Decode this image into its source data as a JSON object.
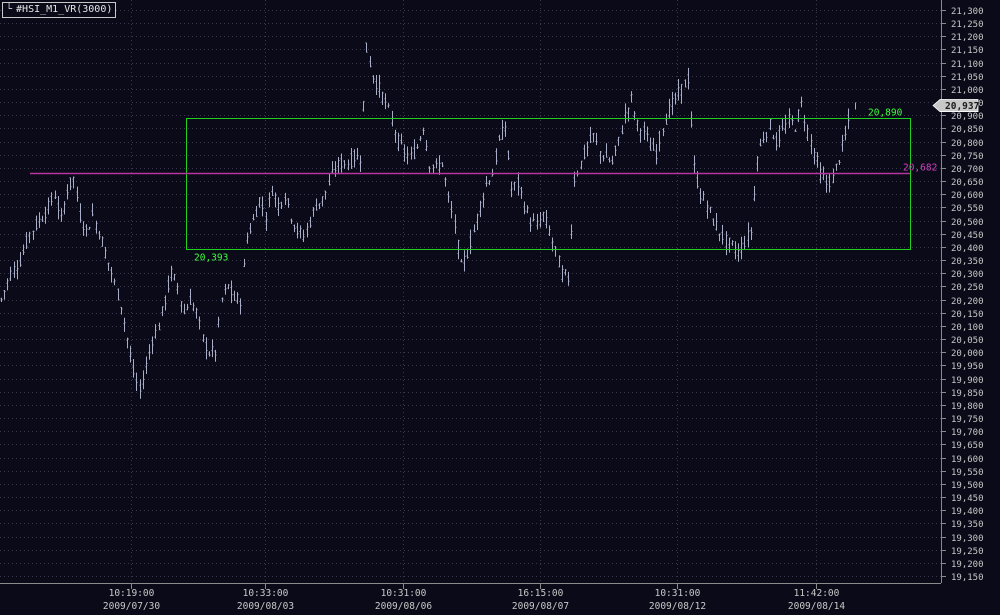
{
  "window": {
    "title": "#HSI_M1_VR(3000)",
    "corner_icon": "chart-corner-icon"
  },
  "colors": {
    "background": "#0b0a18",
    "bars": "#a8aec8",
    "grid": "#3a3a4a",
    "range_box": "#1fd11f",
    "pivot_line": "#b5359e",
    "pivot_label": "#d040c0",
    "range_label": "#3cff3c",
    "price_tag_bg": "#c8c8c8",
    "axis_text": "#c8c8c8"
  },
  "chart_data": {
    "type": "ohlc",
    "title": "#HSI_M1_VR(3000)",
    "xlabel": "",
    "ylabel": "",
    "ylim": [
      19125,
      21325
    ],
    "grid": true,
    "y_ticks": [
      "21,300",
      "21,250",
      "21,200",
      "21,150",
      "21,100",
      "21,050",
      "21,000",
      "20,950",
      "20,900",
      "20,850",
      "20,800",
      "20,750",
      "20,700",
      "20,650",
      "20,600",
      "20,550",
      "20,500",
      "20,450",
      "20,400",
      "20,350",
      "20,300",
      "20,250",
      "20,200",
      "20,150",
      "20,100",
      "20,050",
      "20,000",
      "19,950",
      "19,900",
      "19,850",
      "19,800",
      "19,750",
      "19,700",
      "19,650",
      "19,600",
      "19,550",
      "19,500",
      "19,450",
      "19,400",
      "19,350",
      "19,300",
      "19,250",
      "19,200",
      "19,150"
    ],
    "x_ticks": [
      {
        "time": "10:19:00",
        "date": "2009/07/30"
      },
      {
        "time": "10:33:00",
        "date": "2009/08/03"
      },
      {
        "time": "10:31:00",
        "date": "2009/08/06"
      },
      {
        "time": "16:15:00",
        "date": "2009/08/07"
      },
      {
        "time": "10:31:00",
        "date": "2009/08/12"
      },
      {
        "time": "11:42:00",
        "date": "2009/08/14"
      }
    ],
    "current_price": "20,937",
    "current_price_value": 20937,
    "range": {
      "upper": 20890,
      "upper_label": "20,890",
      "lower": 20393,
      "lower_label": "20,393"
    },
    "pivot": {
      "value": 20682,
      "label": "20,682"
    },
    "close_path": [
      [
        0,
        20200
      ],
      [
        3,
        20300
      ],
      [
        6,
        20350
      ],
      [
        9,
        20450
      ],
      [
        12,
        20500
      ],
      [
        15,
        20550
      ],
      [
        17,
        20600
      ],
      [
        19,
        20500
      ],
      [
        21,
        20620
      ],
      [
        23,
        20660
      ],
      [
        25,
        20520
      ],
      [
        27,
        20460
      ],
      [
        29,
        20520
      ],
      [
        31,
        20460
      ],
      [
        33,
        20380
      ],
      [
        35,
        20300
      ],
      [
        38,
        20180
      ],
      [
        40,
        20050
      ],
      [
        42,
        19920
      ],
      [
        44,
        19850
      ],
      [
        46,
        19950
      ],
      [
        48,
        20050
      ],
      [
        50,
        20100
      ],
      [
        52,
        20200
      ],
      [
        54,
        20300
      ],
      [
        56,
        20250
      ],
      [
        58,
        20150
      ],
      [
        60,
        20200
      ],
      [
        62,
        20150
      ],
      [
        64,
        20050
      ],
      [
        66,
        20000
      ],
      [
        68,
        20000
      ],
      [
        70,
        20200
      ],
      [
        72,
        20250
      ],
      [
        74,
        20200
      ],
      [
        76,
        20200
      ],
      [
        78,
        20440
      ],
      [
        80,
        20500
      ],
      [
        82,
        20580
      ],
      [
        84,
        20520
      ],
      [
        86,
        20620
      ],
      [
        88,
        20560
      ],
      [
        90,
        20600
      ],
      [
        92,
        20520
      ],
      [
        94,
        20460
      ],
      [
        96,
        20440
      ],
      [
        98,
        20500
      ],
      [
        100,
        20560
      ],
      [
        102,
        20580
      ],
      [
        104,
        20640
      ],
      [
        106,
        20700
      ],
      [
        108,
        20720
      ],
      [
        110,
        20720
      ],
      [
        112,
        20740
      ],
      [
        114,
        20740
      ],
      [
        116,
        21150
      ],
      [
        118,
        21050
      ],
      [
        120,
        21000
      ],
      [
        122,
        20950
      ],
      [
        124,
        20880
      ],
      [
        126,
        20800
      ],
      [
        128,
        20760
      ],
      [
        130,
        20740
      ],
      [
        132,
        20780
      ],
      [
        134,
        20860
      ],
      [
        136,
        20720
      ],
      [
        138,
        20700
      ],
      [
        140,
        20720
      ],
      [
        142,
        20580
      ],
      [
        144,
        20480
      ],
      [
        146,
        20320
      ],
      [
        148,
        20380
      ],
      [
        150,
        20460
      ],
      [
        152,
        20560
      ],
      [
        154,
        20640
      ],
      [
        156,
        20680
      ],
      [
        158,
        20800
      ],
      [
        160,
        20860
      ],
      [
        162,
        20620
      ],
      [
        164,
        20640
      ],
      [
        166,
        20560
      ],
      [
        168,
        20500
      ],
      [
        170,
        20480
      ],
      [
        172,
        20520
      ],
      [
        174,
        20460
      ],
      [
        176,
        20380
      ],
      [
        178,
        20300
      ],
      [
        180,
        20280
      ],
      [
        182,
        20660
      ],
      [
        184,
        20720
      ],
      [
        186,
        20780
      ],
      [
        188,
        20820
      ],
      [
        190,
        20760
      ],
      [
        192,
        20740
      ],
      [
        194,
        20720
      ],
      [
        196,
        20800
      ],
      [
        198,
        20900
      ],
      [
        200,
        20960
      ],
      [
        202,
        20860
      ],
      [
        204,
        20840
      ],
      [
        206,
        20780
      ],
      [
        208,
        20760
      ],
      [
        210,
        20860
      ],
      [
        212,
        20920
      ],
      [
        214,
        20960
      ],
      [
        216,
        21000
      ],
      [
        218,
        21040
      ],
      [
        220,
        20700
      ],
      [
        222,
        20600
      ],
      [
        224,
        20560
      ],
      [
        226,
        20500
      ],
      [
        228,
        20460
      ],
      [
        230,
        20420
      ],
      [
        232,
        20400
      ],
      [
        234,
        20380
      ],
      [
        236,
        20420
      ],
      [
        238,
        20460
      ],
      [
        240,
        20740
      ],
      [
        242,
        20820
      ],
      [
        244,
        20860
      ],
      [
        246,
        20800
      ],
      [
        248,
        20840
      ],
      [
        250,
        20880
      ],
      [
        252,
        20860
      ],
      [
        254,
        20940
      ],
      [
        256,
        20840
      ],
      [
        258,
        20760
      ],
      [
        260,
        20680
      ],
      [
        262,
        20640
      ],
      [
        264,
        20660
      ],
      [
        266,
        20740
      ],
      [
        268,
        20820
      ],
      [
        270,
        20937
      ]
    ]
  }
}
